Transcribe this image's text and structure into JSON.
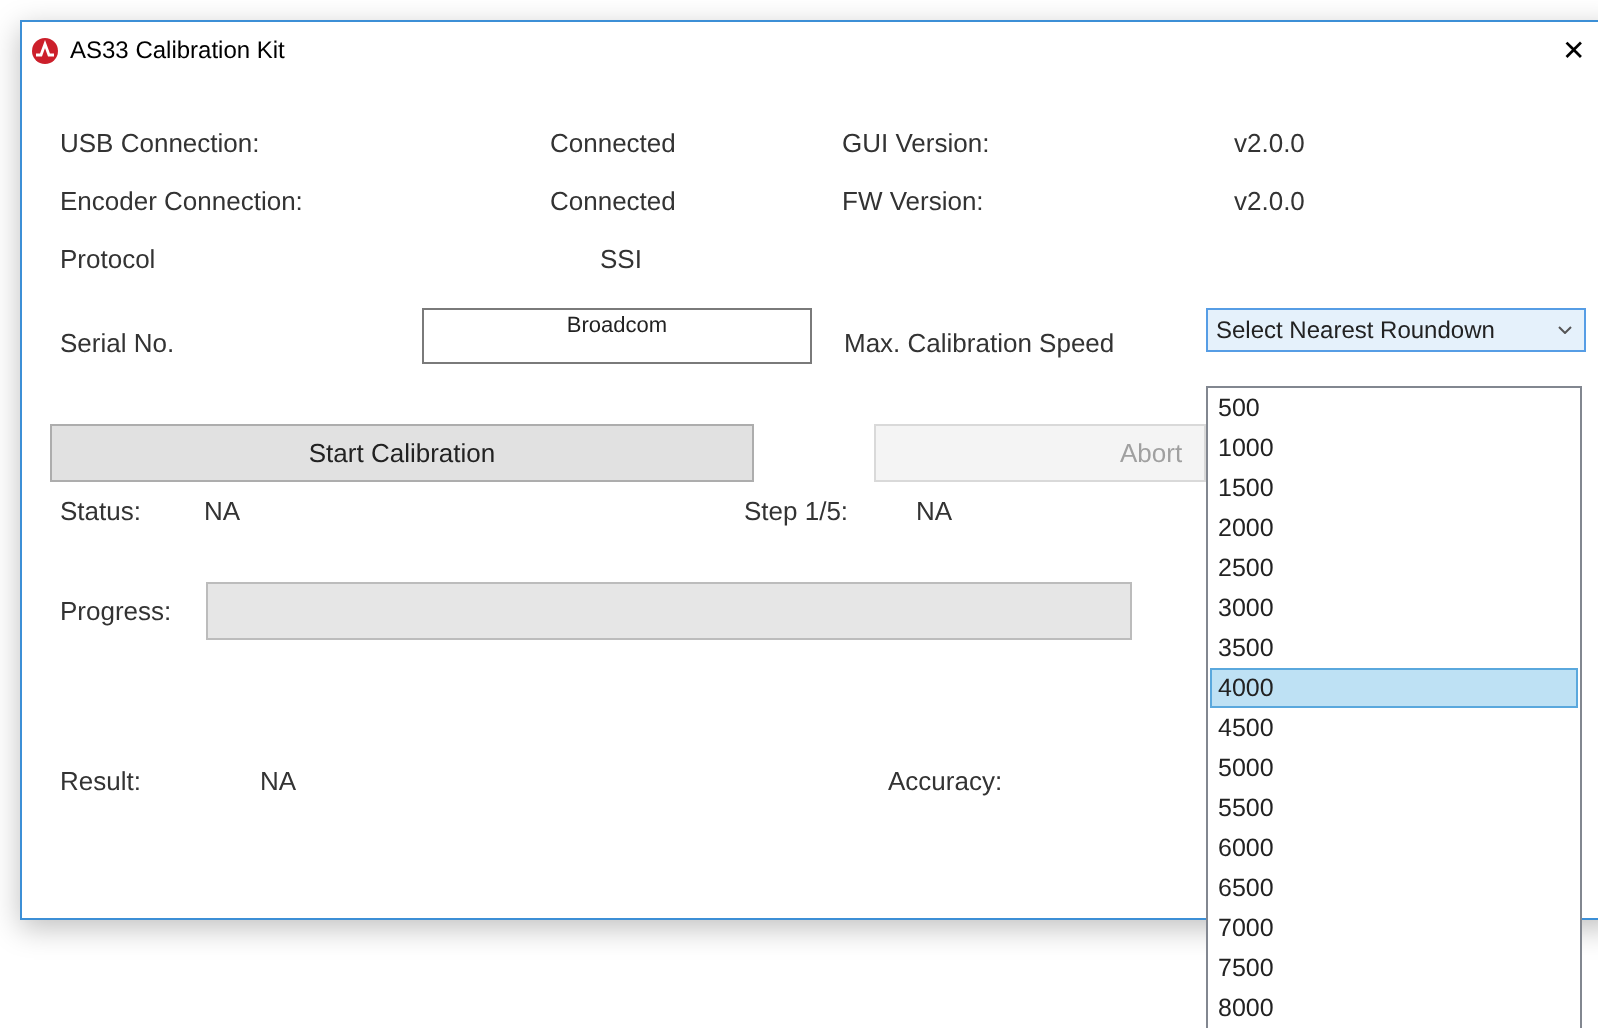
{
  "window": {
    "title": "AS33 Calibration Kit",
    "close": "✕"
  },
  "info": [
    {
      "label": "USB Connection:",
      "value": "Connected",
      "label2": "GUI Version:",
      "value2": "v2.0.0"
    },
    {
      "label": "Encoder Connection:",
      "value": "Connected",
      "label2": "FW Version:",
      "value2": "v2.0.0"
    },
    {
      "label": "Protocol",
      "value": "SSI"
    }
  ],
  "serial": {
    "label": "Serial No.",
    "value": "Broadcom"
  },
  "speed": {
    "label": "Max. Calibration Speed",
    "value": "Select Nearest Roundown",
    "expanded": true,
    "options": [
      {
        "label": "500",
        "selected": false
      },
      {
        "label": "1000",
        "selected": false
      },
      {
        "label": "1500",
        "selected": false
      },
      {
        "label": "2000",
        "selected": false
      },
      {
        "label": "2500",
        "selected": false
      },
      {
        "label": "3000",
        "selected": false
      },
      {
        "label": "3500",
        "selected": false
      },
      {
        "label": "4000",
        "selected": true
      },
      {
        "label": "4500",
        "selected": false
      },
      {
        "label": "5000",
        "selected": false
      },
      {
        "label": "5500",
        "selected": false
      },
      {
        "label": "6000",
        "selected": false
      },
      {
        "label": "6500",
        "selected": false
      },
      {
        "label": "7000",
        "selected": false
      },
      {
        "label": "7500",
        "selected": false
      },
      {
        "label": "8000",
        "selected": false
      }
    ]
  },
  "buttons": [
    {
      "label": "Start Calibration",
      "disabled": false
    },
    {
      "label": "Abort",
      "disabled": true
    }
  ],
  "status": {
    "label": "Status:",
    "value": "NA",
    "step_label": "Step 1/5:",
    "step_value": "NA"
  },
  "progress": {
    "label": "Progress:",
    "level": 0
  },
  "result": {
    "label": "Result:",
    "value": "NA",
    "accuracy_label": "Accuracy:"
  }
}
